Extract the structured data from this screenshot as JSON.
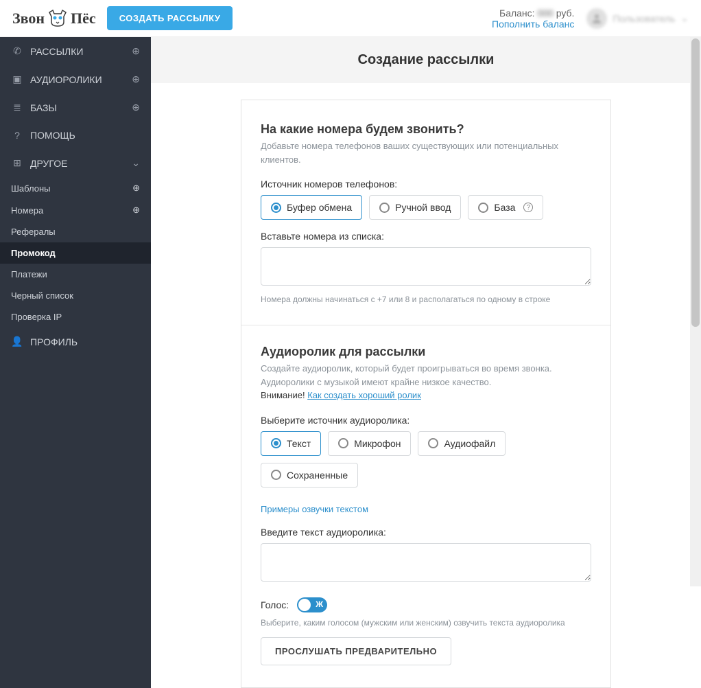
{
  "header": {
    "logo_left": "Звон",
    "logo_right": "Пёс",
    "create_button": "СОЗДАТЬ РАССЫЛКУ",
    "balance_label": "Баланс:",
    "balance_currency": "руб.",
    "balance_link": "Пополнить баланс",
    "user_name": "Пользователь"
  },
  "sidebar": {
    "items": [
      {
        "label": "РАССЫЛКИ"
      },
      {
        "label": "АУДИОРОЛИКИ"
      },
      {
        "label": "БАЗЫ"
      },
      {
        "label": "ПОМОЩЬ"
      },
      {
        "label": "ДРУГОЕ"
      }
    ],
    "subs": [
      {
        "label": "Шаблоны",
        "add": true
      },
      {
        "label": "Номера",
        "add": true
      },
      {
        "label": "Рефералы"
      },
      {
        "label": "Промокод",
        "active": true
      },
      {
        "label": "Платежи"
      },
      {
        "label": "Черный список"
      },
      {
        "label": "Проверка IP"
      }
    ],
    "profile": "ПРОФИЛЬ"
  },
  "content": {
    "page_title": "Создание рассылки",
    "numbers": {
      "title": "На какие номера будем звонить?",
      "desc": "Добавьте номера телефонов ваших существующих или потенциальных клиентов.",
      "source_label": "Источник номеров телефонов:",
      "options": [
        "Буфер обмена",
        "Ручной ввод",
        "База"
      ],
      "paste_label": "Вставьте номера из списка:",
      "hint": "Номера должны начинаться с +7 или 8 и располагаться по одному в строке"
    },
    "audio": {
      "title": "Аудиоролик для рассылки",
      "desc1": "Создайте аудиоролик, который будет проигрываться во время звонка.",
      "desc2": "Аудиоролики с музыкой имеют крайне низкое качество.",
      "warn": "Внимание!",
      "warn_link": "Как создать хороший ролик",
      "source_label": "Выберите источник аудиоролика:",
      "options": [
        "Текст",
        "Микрофон",
        "Аудиофайл",
        "Сохраненные"
      ],
      "examples_link": "Примеры озвучки текстом",
      "text_label": "Введите текст аудиоролика:",
      "voice_label": "Голос:",
      "voice_toggle": "Ж",
      "voice_hint": "Выберите, каким голосом (мужским или женским) озвучить текста аудиоролика",
      "preview_btn": "ПРОСЛУШАТЬ ПРЕДВАРИТЕЛЬНО"
    }
  }
}
